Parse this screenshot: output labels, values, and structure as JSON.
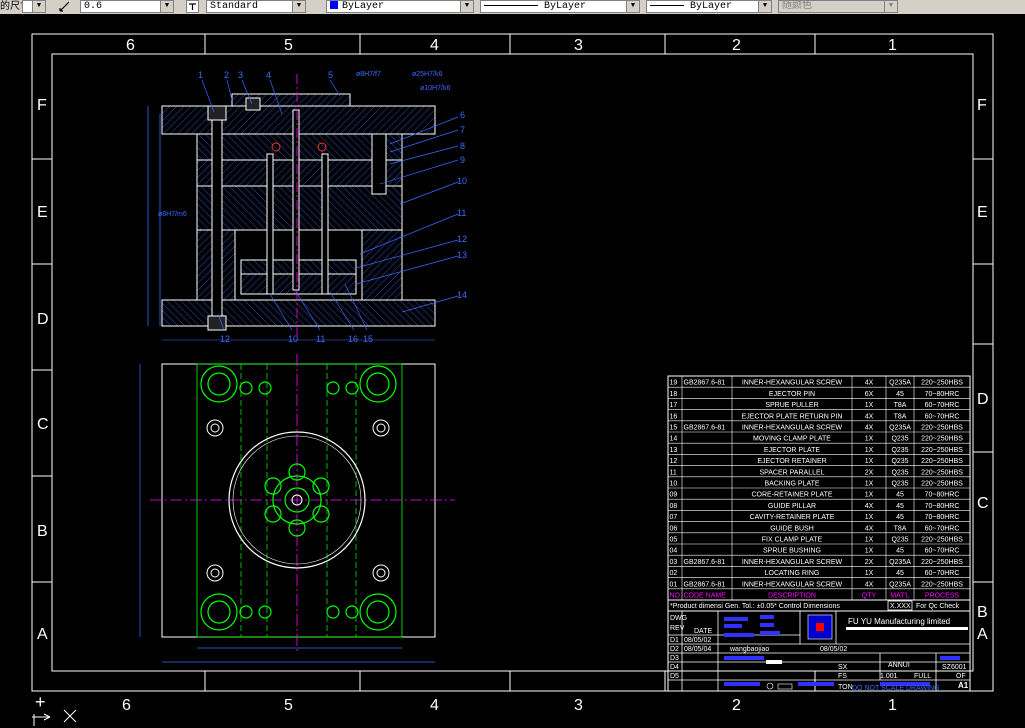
{
  "toolbar": {
    "dim_label": "的尺寸",
    "scale_value": "0.6",
    "text_style": "Standard",
    "layer_color": "ByLayer",
    "linetype": "ByLayer",
    "lineweight": "ByLayer",
    "plot_style": "随颜色",
    "colors": {
      "layer_swatch": "#0000ff"
    }
  },
  "frame": {
    "columns": [
      "6",
      "5",
      "4",
      "3",
      "2",
      "1"
    ],
    "rows": [
      "F",
      "E",
      "D",
      "C",
      "B",
      "A"
    ],
    "right_rows": [
      "F",
      "E",
      "D",
      "C",
      "B",
      "A"
    ],
    "corner_mark": "+",
    "sheet_size": "A1"
  },
  "section_view": {
    "top_tags": [
      "1",
      "2",
      "3",
      "4",
      "5"
    ],
    "right_tags": [
      "6",
      "7",
      "8",
      "9",
      "10",
      "11",
      "12",
      "13",
      "14"
    ],
    "bottom_tags": [
      "12",
      "10",
      "11",
      "16",
      "15"
    ],
    "fit_labels": [
      "ø8H7/f7",
      "ø25H7/k6",
      "ø10H7/k6",
      "ø8H7/m6"
    ]
  },
  "bom": {
    "rows": [
      {
        "no": "19",
        "code": "GB2867.6-81",
        "desc": "INNER-HEXANGULAR SCREW",
        "qty": "4X",
        "mat": "Q235A",
        "proc": "220~250HBS"
      },
      {
        "no": "18",
        "code": "",
        "desc": "EJECTOR PIN",
        "qty": "6X",
        "mat": "45",
        "proc": "70~80HRC"
      },
      {
        "no": "17",
        "code": "",
        "desc": "SPRUE PULLER",
        "qty": "1X",
        "mat": "T8A",
        "proc": "60~70HRC"
      },
      {
        "no": "16",
        "code": "",
        "desc": "EJECTOR PLATE RETURN PIN",
        "qty": "4X",
        "mat": "T8A",
        "proc": "60~70HRC"
      },
      {
        "no": "15",
        "code": "GB2867.6-81",
        "desc": "INNER-HEXANGULAR SCREW",
        "qty": "4X",
        "mat": "Q235A",
        "proc": "220~250HBS"
      },
      {
        "no": "14",
        "code": "",
        "desc": "MOVING CLAMP PLATE",
        "qty": "1X",
        "mat": "Q235",
        "proc": "220~250HBS"
      },
      {
        "no": "13",
        "code": "",
        "desc": "EJECTOR PLATE",
        "qty": "1X",
        "mat": "Q235",
        "proc": "220~250HBS"
      },
      {
        "no": "12",
        "code": "",
        "desc": "EJECTOR RETAINER",
        "qty": "1X",
        "mat": "Q235",
        "proc": "220~250HBS"
      },
      {
        "no": "11",
        "code": "",
        "desc": "SPACER PARALLEL",
        "qty": "2X",
        "mat": "Q235",
        "proc": "220~250HBS"
      },
      {
        "no": "10",
        "code": "",
        "desc": "BACKING PLATE",
        "qty": "1X",
        "mat": "Q235",
        "proc": "220~250HBS"
      },
      {
        "no": "09",
        "code": "",
        "desc": "CORE-RETAINER PLATE",
        "qty": "1X",
        "mat": "45",
        "proc": "70~80HRC"
      },
      {
        "no": "08",
        "code": "",
        "desc": "GUIDE PILLAR",
        "qty": "4X",
        "mat": "45",
        "proc": "70~80HRC"
      },
      {
        "no": "07",
        "code": "",
        "desc": "CAVITY-RETAINER PLATE",
        "qty": "1X",
        "mat": "45",
        "proc": "70~80HRC"
      },
      {
        "no": "06",
        "code": "",
        "desc": "GUIDE BUSH",
        "qty": "4X",
        "mat": "T8A",
        "proc": "60~70HRC"
      },
      {
        "no": "05",
        "code": "",
        "desc": "FIX CLAMP PLATE",
        "qty": "1X",
        "mat": "Q235",
        "proc": "220~250HBS"
      },
      {
        "no": "04",
        "code": "",
        "desc": "SPRUE BUSHING",
        "qty": "1X",
        "mat": "45",
        "proc": "60~70HRC"
      },
      {
        "no": "03",
        "code": "GB2867.6-81",
        "desc": "INNER-HEXANGULAR SCREW",
        "qty": "2X",
        "mat": "Q235A",
        "proc": "220~250HBS"
      },
      {
        "no": "02",
        "code": "",
        "desc": "LOCATING RING",
        "qty": "1X",
        "mat": "45",
        "proc": "60~70HRC"
      },
      {
        "no": "01",
        "code": "GB2867.6-81",
        "desc": "INNER-HEXANGULAR SCREW",
        "qty": "4X",
        "mat": "Q235A",
        "proc": "220~250HBS"
      }
    ],
    "header": {
      "no": "NO",
      "code": "CODE NAME",
      "desc": "DESCRIPTION",
      "qty": "QTY",
      "mat": "MAT'L",
      "proc": "PROCESS"
    }
  },
  "title_block": {
    "tolerance_note": "*Product dimensi Gen. Tol.: ±0.05* Control Dimensions",
    "qc_box": "X.XXX",
    "qc_note": "For Qc Check",
    "dwg": "DWG",
    "rev": "REV",
    "date": "DATE",
    "company": "FU  YU  Manufacturing  limited",
    "d1": "D1",
    "d1_date": "08/05/02",
    "d2": "D2",
    "d2_date": "08/05/04",
    "d3": "D3",
    "d4": "D4",
    "d5": "D5",
    "designer": "wangbaojiao",
    "date_right": "08/05/02",
    "sx": "SX",
    "fs": "FS",
    "ton": "TON",
    "part_name": "ANNUI",
    "scale_ratio": "1.001",
    "scale_full": "FULL",
    "part_no": "SZ6001",
    "of": "OF",
    "footer": "DO  NOT  SCALE  DRAWING"
  }
}
